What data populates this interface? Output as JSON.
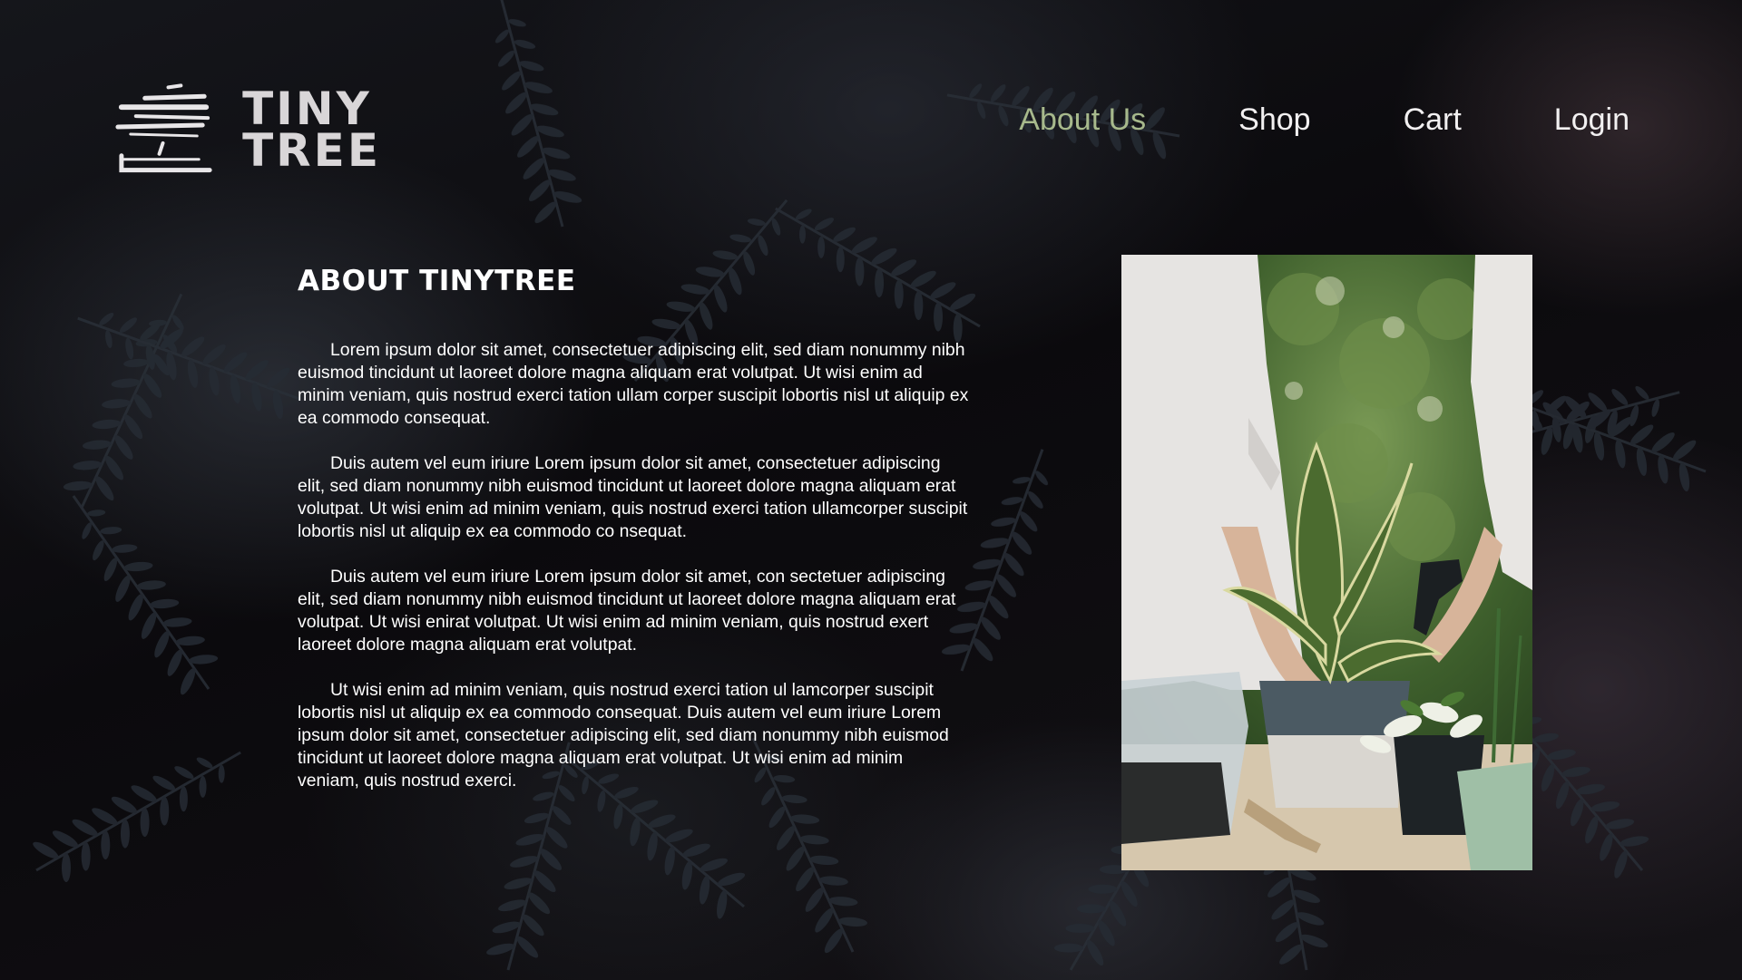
{
  "brand": {
    "line1": "TINY",
    "line2": "TREE",
    "logo_icon": "stacked-brush-strokes-icon"
  },
  "nav": {
    "items": [
      {
        "label": "About Us",
        "active": true
      },
      {
        "label": "Shop",
        "active": false
      },
      {
        "label": "Cart",
        "active": false
      },
      {
        "label": "Login",
        "active": false
      }
    ],
    "active_color": "#a7b98c",
    "text_color": "#f2f0f1"
  },
  "about": {
    "title": "ABOUT TINYTREE",
    "paragraphs": [
      "Lorem ipsum dolor sit amet, consectetuer adipiscing elit, sed diam nonummy nibh euismod tincidunt ut laoreet dolore magna aliquam erat volutpat. Ut wisi enim ad minim veniam, quis nostrud exerci tation ullam corper suscipit lobortis nisl ut aliquip ex ea commodo consequat.",
      "Duis autem vel eum iriure Lorem ipsum dolor sit amet, consectetuer adipiscing elit, sed diam nonummy nibh euismod tincidunt ut laoreet dolore magna aliquam erat volutpat. Ut wisi enim ad minim veniam, quis nostrud exerci tation ullamcorper suscipit lobortis nisl ut aliquip ex ea commodo co nsequat.",
      "Duis autem vel eum iriure Lorem ipsum dolor sit amet, con sectetuer adipiscing elit, sed diam nonummy nibh euismod tincidunt ut laoreet dolore magna aliquam erat volutpat. Ut wisi enirat volutpat. Ut wisi enim ad minim veniam, quis nostrud exert laoreet dolore magna aliquam erat volutpat.",
      "Ut wisi enim ad minim veniam, quis nostrud exerci tation ul lamcorper suscipit lobortis nisl ut aliquip ex ea commodo consequat. Duis autem vel eum iriure Lorem ipsum dolor sit amet, consectetuer adipiscing elit, sed diam nonummy nibh euismod tincidunt ut laoreet dolore magna aliquam erat volutpat. Ut wisi enim ad minim veniam, quis nostrud exerci."
    ]
  },
  "photo": {
    "subject": "two-people-potting-plants-photo"
  },
  "background": {
    "subject": "dark-fern-leaves-background",
    "base_color": "#0d0b0e"
  }
}
